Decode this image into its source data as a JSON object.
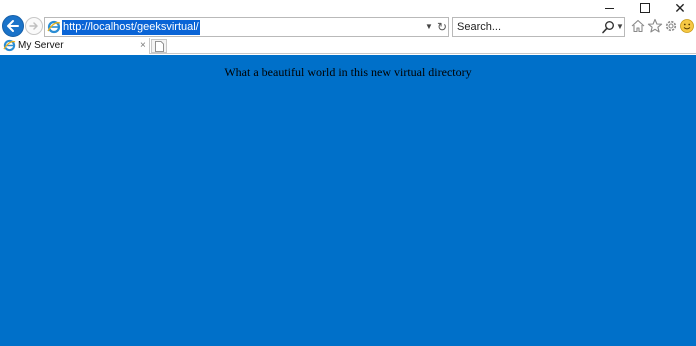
{
  "window": {
    "minimize_icon": "minimize-icon",
    "maximize_icon": "maximize-icon",
    "close_glyph": "✕"
  },
  "toolbar": {
    "back_icon": "back-arrow-icon",
    "forward_icon": "forward-arrow-icon",
    "address": {
      "url": "http://localhost/geeksvirtual/",
      "site_icon": "ie-logo-icon",
      "dropdown_glyph": "▼",
      "refresh_glyph": "↻"
    },
    "search": {
      "placeholder": "Search...",
      "dropdown_glyph": "▼"
    },
    "icons": [
      "home-icon",
      "favorites-star-icon",
      "gear-icon",
      "smiley-feedback-icon"
    ]
  },
  "tabs": [
    {
      "label": "My Server",
      "close_glyph": "×",
      "active": true
    }
  ],
  "page": {
    "text": "What a beautiful world in this new virtual directory",
    "background": "#0070c9"
  },
  "colors": {
    "accent": "#1a73c9",
    "selection": "#0a64d6",
    "page_background": "#0070c9"
  }
}
